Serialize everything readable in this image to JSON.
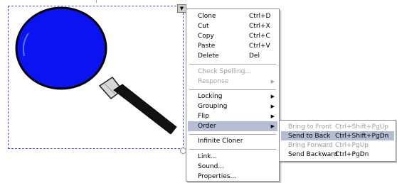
{
  "context_menu": {
    "items": [
      {
        "label": "Clone",
        "shortcut": "Ctrl+D",
        "enabled": true
      },
      {
        "label": "Cut",
        "shortcut": "Ctrl+X",
        "enabled": true
      },
      {
        "label": "Copy",
        "shortcut": "Ctrl+C",
        "enabled": true
      },
      {
        "label": "Paste",
        "shortcut": "Ctrl+V",
        "enabled": true
      },
      {
        "label": "Delete",
        "shortcut": "Del",
        "enabled": true
      },
      {
        "label": "Check Spelling...",
        "enabled": false
      },
      {
        "label": "Response",
        "enabled": false,
        "submenu": true
      },
      {
        "label": "Locking",
        "enabled": true,
        "submenu": true
      },
      {
        "label": "Grouping",
        "enabled": true,
        "submenu": true
      },
      {
        "label": "Flip",
        "enabled": true,
        "submenu": true
      },
      {
        "label": "Order",
        "enabled": true,
        "submenu": true,
        "highlighted": true
      },
      {
        "label": "Infinite Cloner",
        "enabled": true
      },
      {
        "label": "Link...",
        "enabled": true
      },
      {
        "label": "Sound...",
        "enabled": true
      },
      {
        "label": "Properties...",
        "enabled": true
      }
    ],
    "arrow_glyph": "▶"
  },
  "order_submenu": {
    "items": [
      {
        "label": "Bring to Front",
        "shortcut": "Ctrl+Shift+PgUp",
        "enabled": false
      },
      {
        "label": "Send to Back",
        "shortcut": "Ctrl+Shift+PgDn",
        "enabled": true,
        "highlighted": true
      },
      {
        "label": "Bring Forward",
        "shortcut": "Ctrl+PgUp",
        "enabled": false
      },
      {
        "label": "Send Backward",
        "shortcut": "Ctrl+PgDn",
        "enabled": true
      }
    ]
  },
  "object": {
    "icon": "magnifying-glass-icon",
    "lens_color": "#0a14f0",
    "handle_color": "#111111"
  },
  "dropdown_glyph": "▼",
  "colors": {
    "selection_border": "#3a4fd0",
    "highlight": "#b6bdd2",
    "disabled_text": "#a0a0a0"
  }
}
